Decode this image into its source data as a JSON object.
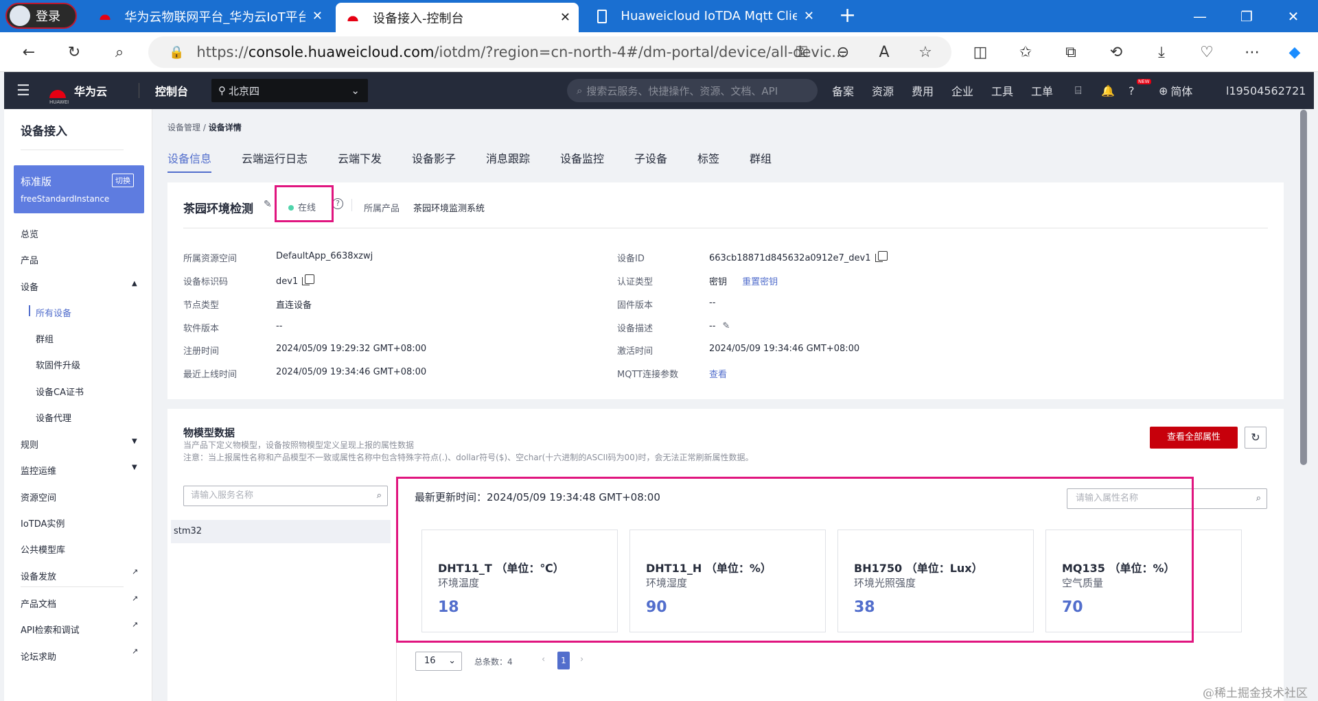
{
  "browser": {
    "login_label": "登录",
    "tabs": [
      {
        "title": "华为云物联网平台_华为云IoT平台",
        "active": false
      },
      {
        "title": "设备接入-控制台",
        "active": true
      },
      {
        "title": "Huaweicloud IoTDA Mqtt ClientId",
        "active": false
      }
    ],
    "url_prefix": "https://",
    "url_host": "console.huaweicloud.com",
    "url_path": "/iotdm/?region=cn-north-4#/dm-portal/device/all-devic..."
  },
  "console_header": {
    "brand": "华为云",
    "huawei_small": "HUAWEI",
    "console_label": "控制台",
    "region": "北京四",
    "search_placeholder": "搜索云服务、快捷操作、资源、文档、API",
    "menu": [
      "备案",
      "资源",
      "费用",
      "企业",
      "工具",
      "工单"
    ],
    "new_badge": "NEW",
    "language": "简体",
    "username": "l19504562721"
  },
  "sidebar": {
    "title": "设备接入",
    "edition": {
      "name": "标准版",
      "switch_label": "切换",
      "instance": "freeStandardInstance"
    },
    "items": [
      {
        "label": "总览"
      },
      {
        "label": "产品"
      },
      {
        "label": "设备"
      },
      {
        "label": "所有设备"
      },
      {
        "label": "群组"
      },
      {
        "label": "软固件升级"
      },
      {
        "label": "设备CA证书"
      },
      {
        "label": "设备代理"
      },
      {
        "label": "规则"
      },
      {
        "label": "监控运维"
      },
      {
        "label": "资源空间"
      },
      {
        "label": "IoTDA实例"
      },
      {
        "label": "公共模型库"
      },
      {
        "label": "设备发放"
      },
      {
        "label": "产品文档"
      },
      {
        "label": "API检索和调试"
      },
      {
        "label": "论坛求助"
      }
    ]
  },
  "breadcrumb": {
    "parent": "设备管理",
    "separator": "/",
    "current": "设备详情"
  },
  "tabs": [
    "设备信息",
    "云端运行日志",
    "云端下发",
    "设备影子",
    "消息跟踪",
    "设备监控",
    "子设备",
    "标签",
    "群组"
  ],
  "device": {
    "name": "茶园环境检测",
    "status": "在线",
    "product_label": "所属产品",
    "product": "茶园环境监测系统",
    "fields_left": [
      {
        "label": "所属资源空间",
        "value": "DefaultApp_6638xzwj"
      },
      {
        "label": "设备标识码",
        "value": "dev1"
      },
      {
        "label": "节点类型",
        "value": "直连设备"
      },
      {
        "label": "软件版本",
        "value": "--"
      },
      {
        "label": "注册时间",
        "value": "2024/05/09 19:29:32 GMT+08:00"
      },
      {
        "label": "最近上线时间",
        "value": "2024/05/09 19:34:46 GMT+08:00"
      }
    ],
    "fields_right": [
      {
        "label": "设备ID",
        "value": "663cb18871d845632a0912e7_dev1"
      },
      {
        "label": "认证类型",
        "value": "密钥",
        "action": "重置密钥"
      },
      {
        "label": "固件版本",
        "value": "--"
      },
      {
        "label": "设备描述",
        "value": "--"
      },
      {
        "label": "激活时间",
        "value": "2024/05/09 19:34:46 GMT+08:00"
      },
      {
        "label": "MQTT连接参数",
        "value": "查看"
      }
    ]
  },
  "model": {
    "title": "物模型数据",
    "desc1": "当产品下定义物模型，设备按照物模型定义呈现上报的属性数据",
    "desc2": "注意：当上报属性名称和产品模型不一致或属性名称中包含特殊字符点(.)、dollar符号($)、空char(十六进制的ASCII码为00)时，会无法正常刷新属性数据。",
    "view_all": "查看全部属性",
    "service_placeholder": "请输入服务名称",
    "services": [
      "stm32"
    ],
    "last_update_label": "最新更新时间：",
    "last_update": "2024/05/09 19:34:48 GMT+08:00",
    "prop_placeholder": "请输入属性名称",
    "properties": [
      {
        "name": "DHT11_T （单位：℃）",
        "desc": "环境温度",
        "value": "18"
      },
      {
        "name": "DHT11_H （单位：%）",
        "desc": "环境湿度",
        "value": "90"
      },
      {
        "name": "BH1750 （单位：Lux）",
        "desc": "环境光照强度",
        "value": "38"
      },
      {
        "name": "MQ135 （单位：%）",
        "desc": "空气质量",
        "value": "70"
      }
    ],
    "page_size": "16",
    "total_label": "总条数：",
    "total": "4",
    "current_page": "1"
  },
  "watermark": "@稀土掘金技术社区",
  "accent_color": "#526ecc",
  "highlight_color": "#e0157f"
}
